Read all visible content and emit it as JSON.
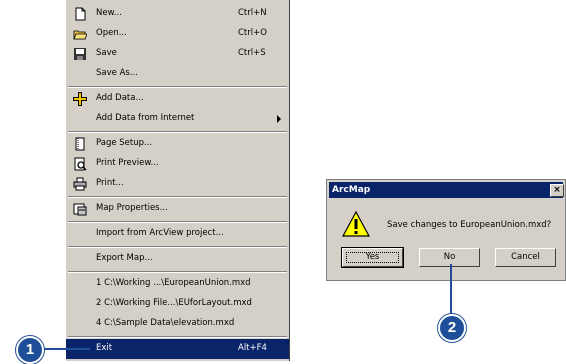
{
  "menu": {
    "items": [
      {
        "label": "New...",
        "shortcut": "Ctrl+N",
        "icon": "new-document-icon"
      },
      {
        "label": "Open...",
        "shortcut": "Ctrl+O",
        "icon": "open-folder-icon"
      },
      {
        "label": "Save",
        "shortcut": "Ctrl+S",
        "icon": "save-disk-icon"
      },
      {
        "label": "Save As...",
        "shortcut": "",
        "icon": ""
      },
      {
        "label": "Add Data...",
        "shortcut": "",
        "icon": "add-data-icon"
      },
      {
        "label": "Add Data from Internet",
        "shortcut": "",
        "icon": "submenu-arrow-icon"
      },
      {
        "label": "Page Setup...",
        "shortcut": "",
        "icon": "page-setup-icon"
      },
      {
        "label": "Print Preview...",
        "shortcut": "",
        "icon": "print-preview-icon"
      },
      {
        "label": "Print...",
        "shortcut": "",
        "icon": "printer-icon"
      },
      {
        "label": "Map Properties...",
        "shortcut": "",
        "icon": "map-properties-icon"
      },
      {
        "label": "Import from ArcView project...",
        "shortcut": "",
        "icon": ""
      },
      {
        "label": "Export Map...",
        "shortcut": "",
        "icon": ""
      },
      {
        "label": "1 C:\\Working ...\\EuropeanUnion.mxd",
        "shortcut": "",
        "icon": ""
      },
      {
        "label": "2 C:\\Working File...\\EUforLayout.mxd",
        "shortcut": "",
        "icon": ""
      },
      {
        "label": "4 C:\\Sample Data\\elevation.mxd",
        "shortcut": "",
        "icon": ""
      },
      {
        "label": "Exit",
        "shortcut": "Alt+F4",
        "icon": "",
        "highlighted": true
      }
    ],
    "highlight_color": "#0a246a"
  },
  "dialog": {
    "title": "ArcMap",
    "close_glyph": "×",
    "message": "Save changes to EuropeanUnion.mxd?",
    "buttons": {
      "yes": "Yes",
      "no": "No",
      "cancel": "Cancel"
    }
  },
  "callouts": {
    "one": "1",
    "two": "2",
    "color": "#1f4f98"
  }
}
